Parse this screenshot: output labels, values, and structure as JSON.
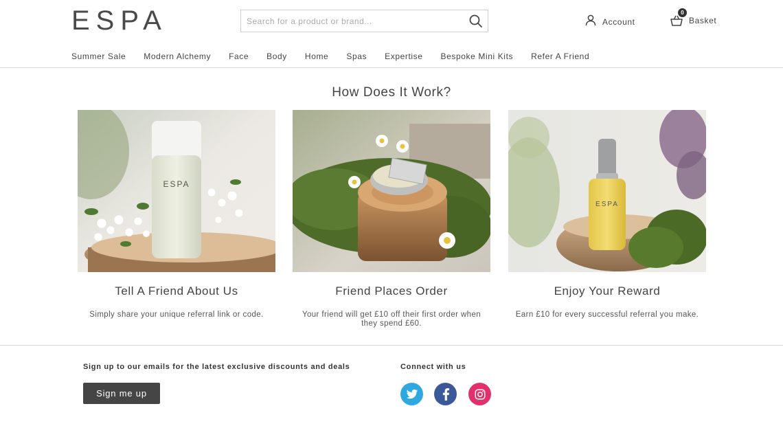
{
  "header": {
    "logo": "ESPA",
    "search_placeholder": "Search for a product or brand...",
    "account_label": "Account",
    "basket_label": "Basket",
    "basket_count": "0"
  },
  "nav": {
    "items": [
      "Summer Sale",
      "Modern Alchemy",
      "Face",
      "Body",
      "Home",
      "Spas",
      "Expertise",
      "Bespoke Mini Kits",
      "Refer A Friend"
    ]
  },
  "main": {
    "title": "How Does It Work?",
    "cards": [
      {
        "title": "Tell A Friend About Us",
        "text": "Simply share your unique referral link or code.",
        "product_label": "ESPA"
      },
      {
        "title": "Friend Places Order",
        "text": "Your friend will get £10 off their first order when they spend £60."
      },
      {
        "title": "Enjoy Your Reward",
        "text": "Earn £10 for every successful referral you make.",
        "product_label": "ESPA"
      }
    ]
  },
  "footer": {
    "signup_text": "Sign up to our emails for the latest exclusive discounts and deals",
    "signup_button": "Sign me up",
    "connect_text": "Connect with us",
    "social": [
      "twitter-icon",
      "facebook-icon",
      "instagram-icon"
    ],
    "social_colors": {
      "twitter": "#2ea8e0",
      "facebook": "#3b5998",
      "instagram": "#e1306c"
    }
  }
}
